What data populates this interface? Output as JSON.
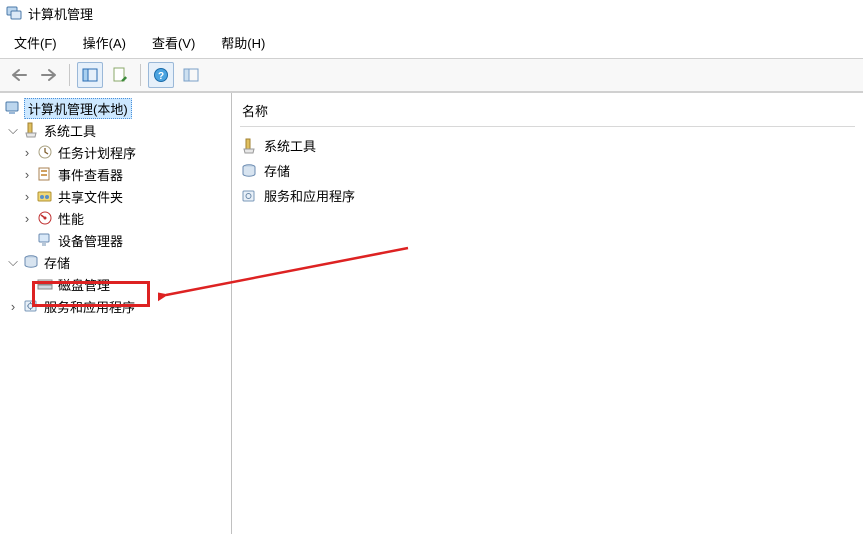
{
  "window": {
    "title": "计算机管理"
  },
  "menu": {
    "file": "文件(F)",
    "action": "操作(A)",
    "view": "查看(V)",
    "help": "帮助(H)"
  },
  "tree": {
    "root": "计算机管理(本地)",
    "system_tools": "系统工具",
    "task_scheduler": "任务计划程序",
    "event_viewer": "事件查看器",
    "shared_folders": "共享文件夹",
    "performance": "性能",
    "device_manager": "设备管理器",
    "storage": "存储",
    "disk_management": "磁盘管理",
    "services_apps": "服务和应用程序"
  },
  "list": {
    "header_name": "名称",
    "items": {
      "system_tools": "系统工具",
      "storage": "存储",
      "services_apps": "服务和应用程序"
    }
  },
  "glyph": {
    "expand": "⌵",
    "collapse": "›"
  }
}
